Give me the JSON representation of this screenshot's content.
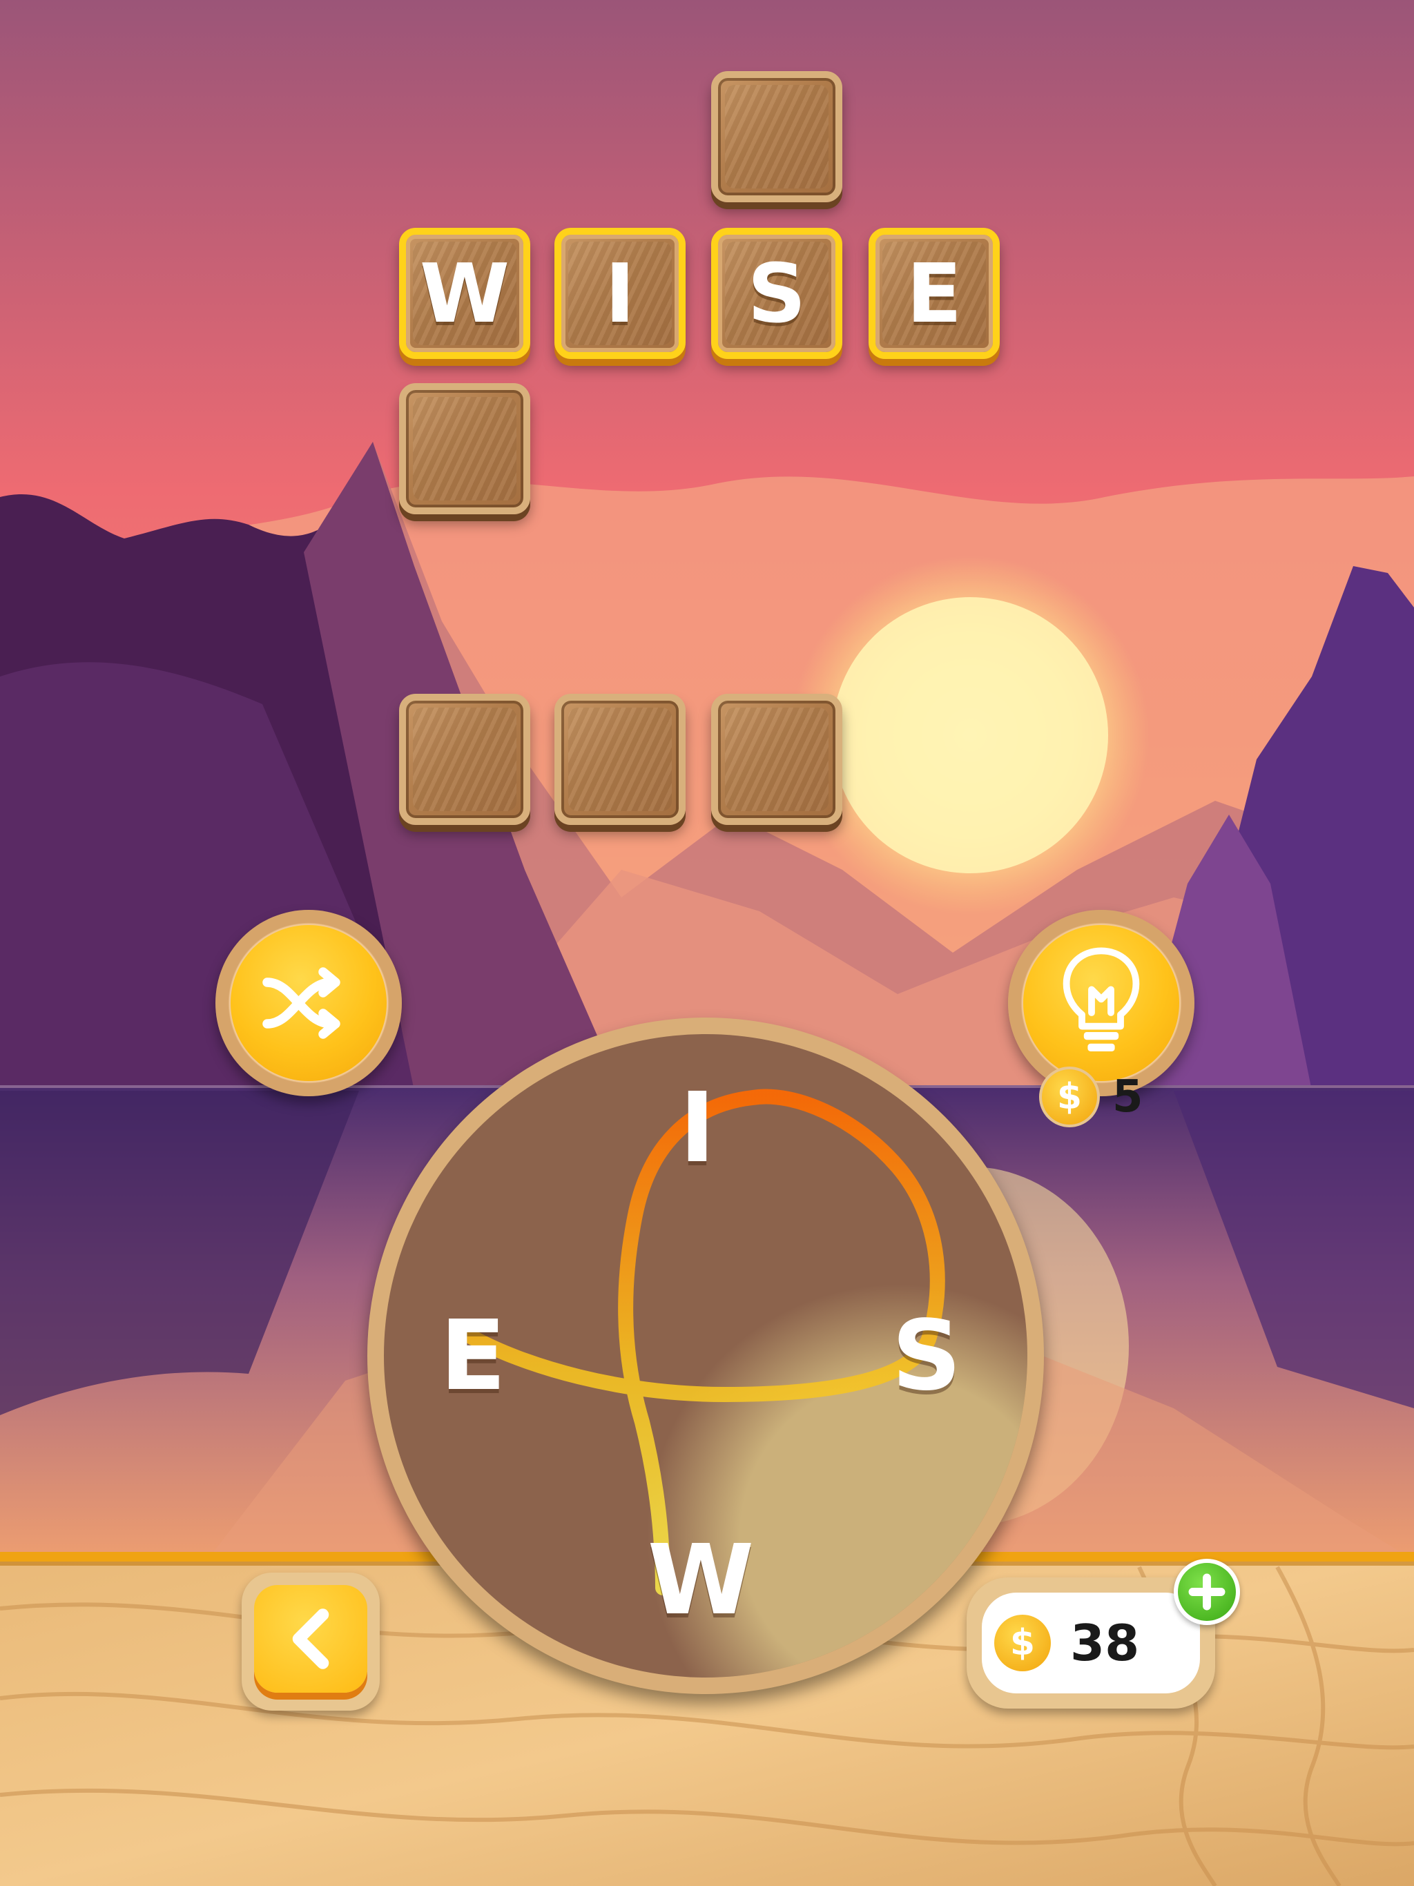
{
  "colors": {
    "sky_top": "#9b5578",
    "sky_mid": "#ee6b72",
    "sun": "#fff5b0",
    "tile_border_solved": "#ffd21a",
    "button_yellow": "#ffc21a",
    "plus_green": "#4cc21d",
    "trail_start": "#ff6a00",
    "trail_end": "#f4e34a"
  },
  "crossword": {
    "solved_word": "WISE",
    "letters": [
      "W",
      "I",
      "S",
      "E"
    ],
    "empty_tiles_count": 5
  },
  "controls": {
    "shuffle_icon": "shuffle-icon",
    "hint_icon": "lightbulb-icon",
    "hint_cost": "5",
    "back_icon": "chevron-left-icon"
  },
  "wheel": {
    "letters": {
      "top": "I",
      "left": "E",
      "right": "S",
      "bottom": "W"
    }
  },
  "wallet": {
    "coins": "38",
    "coin_symbol": "$",
    "add_icon": "plus-icon"
  }
}
